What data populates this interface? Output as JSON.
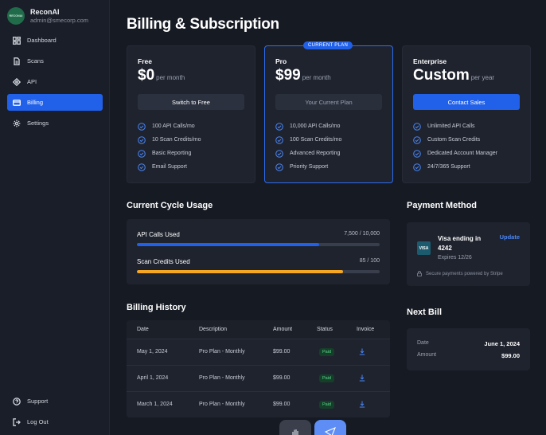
{
  "brand": {
    "logo_text": "RECONAI",
    "name": "ReconAI",
    "email": "admin@smecorp.com"
  },
  "nav": {
    "items": [
      {
        "label": "Dashboard",
        "icon": "dashboard-icon"
      },
      {
        "label": "Scans",
        "icon": "document-icon"
      },
      {
        "label": "API",
        "icon": "api-icon"
      },
      {
        "label": "Billing",
        "icon": "card-icon",
        "active": true
      },
      {
        "label": "Settings",
        "icon": "gear-icon"
      }
    ],
    "bottom": [
      {
        "label": "Support",
        "icon": "help-icon"
      },
      {
        "label": "Log Out",
        "icon": "logout-icon"
      }
    ]
  },
  "page": {
    "title": "Billing & Subscription"
  },
  "plans": [
    {
      "name": "Free",
      "price": "$0",
      "period": "per month",
      "button": "Switch to Free",
      "features": [
        "100 API Calls/mo",
        "10 Scan Credits/mo",
        "Basic Reporting",
        "Email Support"
      ]
    },
    {
      "name": "Pro",
      "price": "$99",
      "period": "per month",
      "button": "Your Current Plan",
      "badge": "CURRENT PLAN",
      "features": [
        "10,000 API Calls/mo",
        "100 Scan Credits/mo",
        "Advanced Reporting",
        "Priority Support"
      ]
    },
    {
      "name": "Enterprise",
      "price": "Custom",
      "period": "per year",
      "button": "Contact Sales",
      "features": [
        "Unlimited API Calls",
        "Custom Scan Credits",
        "Dedicated Account Manager",
        "24/7/365 Support"
      ]
    }
  ],
  "usage": {
    "title": "Current Cycle Usage",
    "items": [
      {
        "label": "API Calls Used",
        "count": "7,500 / 10,000",
        "fraction": 0.75,
        "color": "#2160e8"
      },
      {
        "label": "Scan Credits Used",
        "count": "85 / 100",
        "fraction": 0.85,
        "color": "#f5a623"
      }
    ]
  },
  "history": {
    "title": "Billing History",
    "columns": [
      "Date",
      "Description",
      "Amount",
      "Status",
      "Invoice"
    ],
    "rows": [
      {
        "date": "May 1, 2024",
        "description": "Pro Plan - Monthly",
        "amount": "$99.00",
        "status": "Paid"
      },
      {
        "date": "April 1, 2024",
        "description": "Pro Plan - Monthly",
        "amount": "$99.00",
        "status": "Paid"
      },
      {
        "date": "March 1, 2024",
        "description": "Pro Plan - Monthly",
        "amount": "$99.00",
        "status": "Paid"
      }
    ]
  },
  "payment": {
    "title": "Payment Method",
    "card_brand": "VISA",
    "label": "Visa ending in",
    "last4": "4242",
    "expires": "Expires 12/26",
    "update": "Update",
    "secure": "Secure payments powered by Stripe"
  },
  "next_bill": {
    "title": "Next Bill",
    "date_label": "Date",
    "date_value": "June 1, 2024",
    "amount_label": "Amount",
    "amount_value": "$99.00"
  },
  "colors": {
    "accent": "#2160e8",
    "success": "#5bd68c",
    "warning": "#f5a623"
  }
}
